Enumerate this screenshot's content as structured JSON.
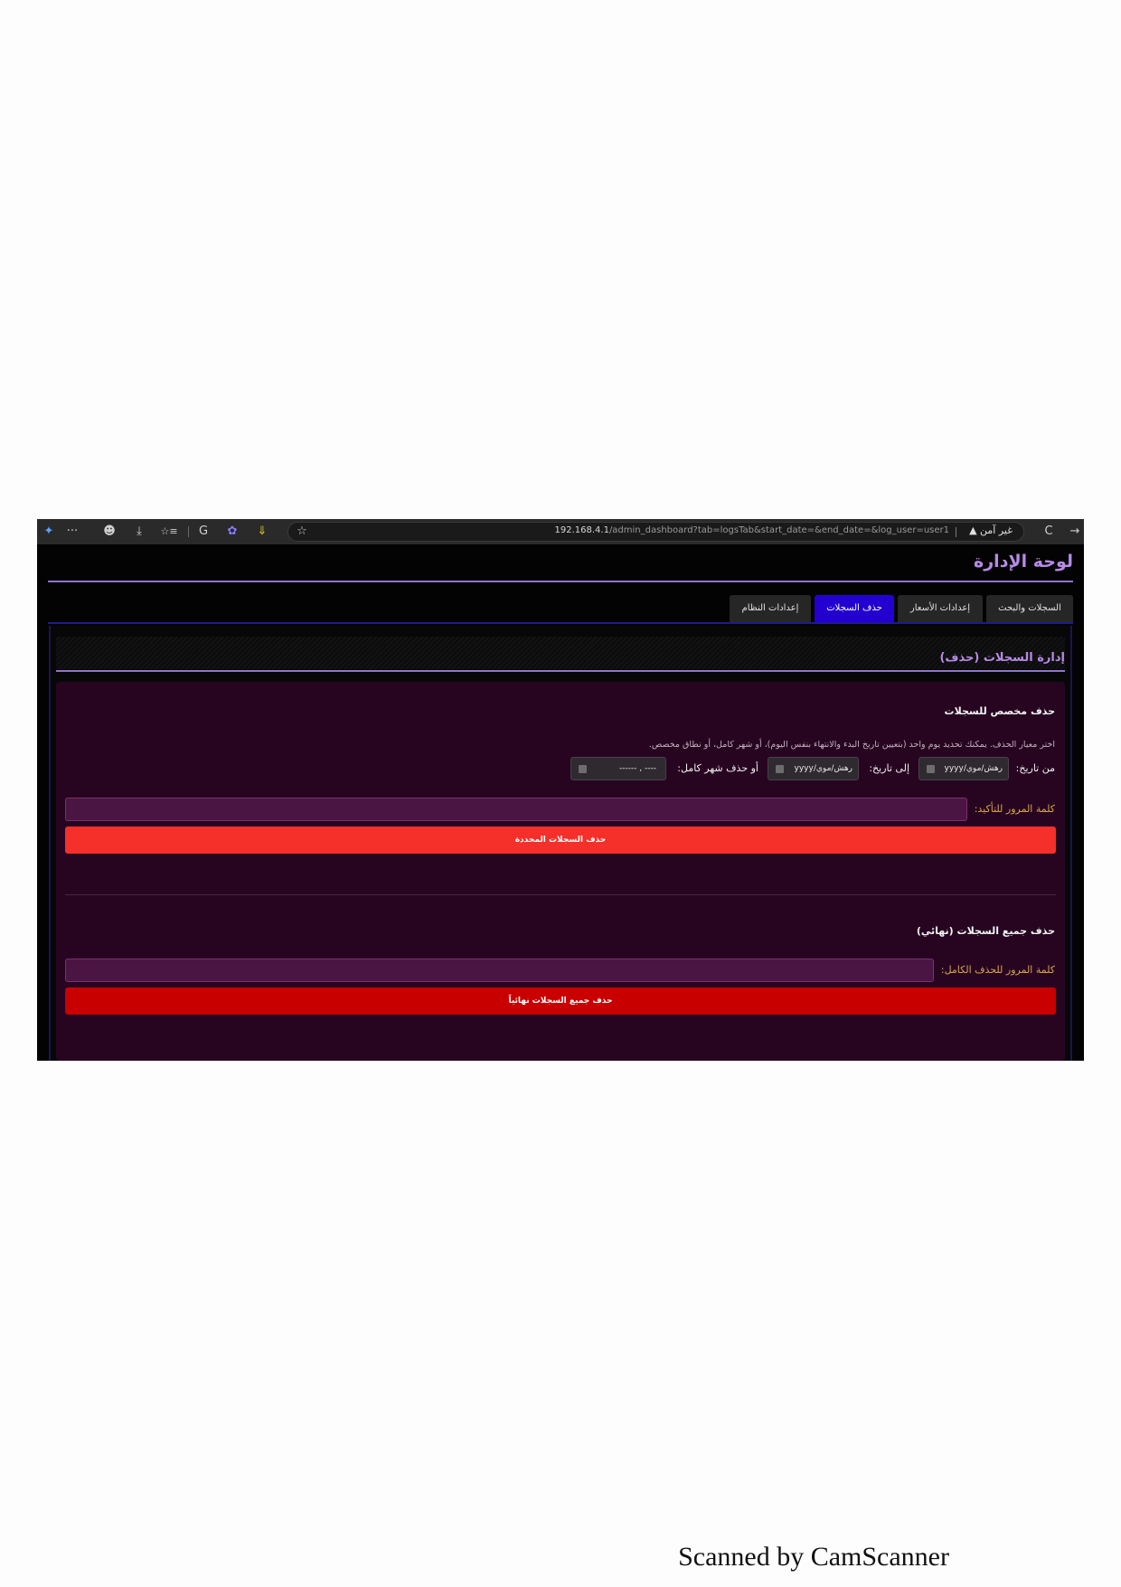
{
  "browser": {
    "url_host": "192.168.4.1",
    "url_path": "/admin_dashboard?tab=logsTab&start_date=&end_date=&log_user=user1",
    "security_text": "غير آمن",
    "icons": {
      "edge": "✦",
      "more": "···",
      "profile": "☻",
      "downloads": "⤓",
      "collections": "☆≡",
      "refresh_ext": "G",
      "ext_colorful": "✿",
      "ext_down": "⇓",
      "favorite": "☆",
      "reload": "C",
      "back": "→",
      "warning": "▲"
    }
  },
  "dashboard": {
    "title": "لوحة الإدارة",
    "tabs": [
      {
        "label": "السجلات والبحث"
      },
      {
        "label": "إعدادات الأسعار"
      },
      {
        "label": "حذف السجلات"
      },
      {
        "label": "إعدادات النظام"
      }
    ],
    "active_tab": "حذف السجلات",
    "colors": {
      "accent": "#b68be6",
      "active_tab": "#2300cf",
      "danger": "#f52f2a",
      "danger_dark": "#c80000",
      "card": "#270521"
    }
  },
  "logs_delete": {
    "section_title": "إدارة السجلات (حذف)",
    "custom": {
      "heading": "حذف مخصص للسجلات",
      "description": "اختر معيار الحذف. يمكنك تحديد يوم واحد (بتعيين تاريخ البدء والانتهاء بنفس اليوم)، أو شهر كامل، أو نطاق مخصص.",
      "from_label": "من تاريخ:",
      "from_value": "yyyy/رهش/موي",
      "to_label": "إلى تاريخ:",
      "to_value": "yyyy/رهش/موي",
      "month_label": "أو حذف شهر كامل:",
      "month_value": "------ ,  ----",
      "password_label": "كلمة المرور للتأكيد:",
      "password_value": "",
      "button": "حذف السجلات المحددة"
    },
    "all": {
      "heading": "حذف جميع السجلات (نهائي)",
      "password_label": "كلمة المرور للحذف الكامل:",
      "password_value": "",
      "button": "حذف جميع السجلات نهائياً"
    }
  },
  "watermark": "Scanned by CamScanner"
}
